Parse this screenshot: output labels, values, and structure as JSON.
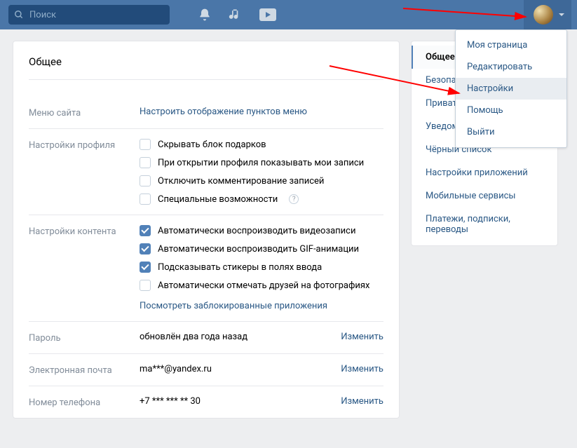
{
  "search": {
    "placeholder": "Поиск"
  },
  "main": {
    "title": "Общее",
    "rows": {
      "menu": {
        "label": "Меню сайта",
        "link": "Настроить отображение пунктов меню"
      },
      "profile": {
        "label": "Настройки профиля",
        "options": [
          {
            "text": "Скрывать блок подарков",
            "checked": false
          },
          {
            "text": "При открытии профиля показывать мои записи",
            "checked": false
          },
          {
            "text": "Отключить комментирование записей",
            "checked": false
          },
          {
            "text": "Специальные возможности",
            "checked": false,
            "hint": "?"
          }
        ]
      },
      "content": {
        "label": "Настройки контента",
        "options": [
          {
            "text": "Автоматически воспроизводить видеозаписи",
            "checked": true
          },
          {
            "text": "Автоматически воспроизводить GIF-анимации",
            "checked": true
          },
          {
            "text": "Подсказывать стикеры в полях ввода",
            "checked": true
          },
          {
            "text": "Автоматически отмечать друзей на фотографиях",
            "checked": false
          }
        ],
        "link": "Посмотреть заблокированные приложения"
      },
      "password": {
        "label": "Пароль",
        "value": "обновлён два года назад",
        "action": "Изменить"
      },
      "email": {
        "label": "Электронная почта",
        "value": "ma***@yandex.ru",
        "action": "Изменить"
      },
      "phone": {
        "label": "Номер телефона",
        "value": "+7 *** *** ** 30",
        "action": "Изменить"
      }
    }
  },
  "sidebar": {
    "items": [
      {
        "label": "Общее",
        "active": true
      },
      {
        "label": "Безопасность"
      },
      {
        "label": "Приватность"
      },
      {
        "label": "Уведомления"
      },
      {
        "label": "Чёрный список"
      },
      {
        "label": "Настройки приложений"
      },
      {
        "label": "Мобильные сервисы"
      },
      {
        "label": "Платежи, подписки, переводы"
      }
    ]
  },
  "dropdown": {
    "items": [
      {
        "label": "Моя страница"
      },
      {
        "label": "Редактировать"
      },
      {
        "label": "Настройки",
        "highlight": true
      },
      {
        "label": "Помощь"
      },
      {
        "label": "Выйти"
      }
    ]
  }
}
